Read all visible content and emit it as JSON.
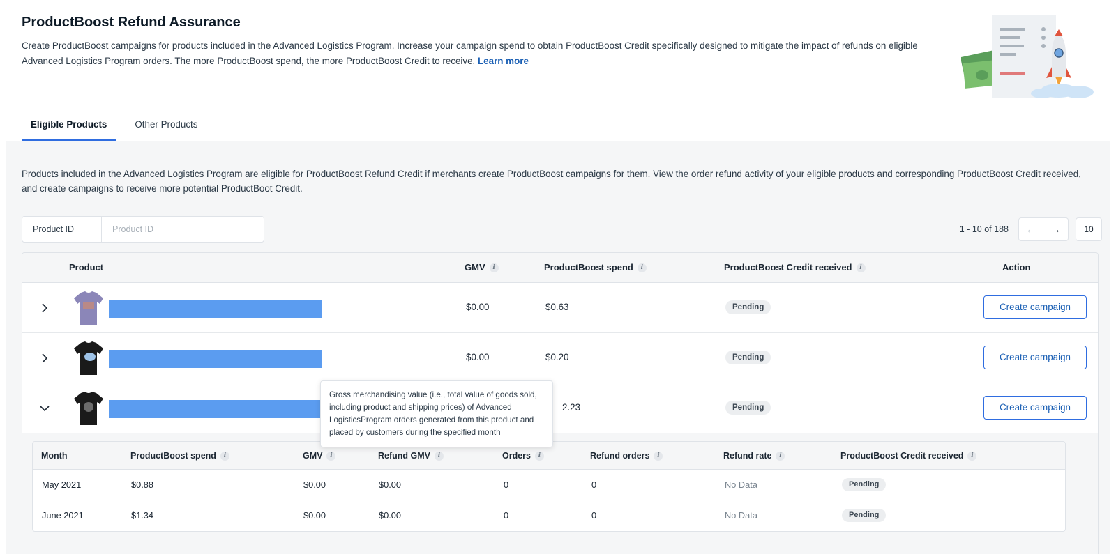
{
  "header": {
    "title": "ProductBoost Refund Assurance",
    "description": "Create ProductBoost campaigns for products included in the Advanced Logistics Program. Increase your campaign spend to obtain ProductBoost Credit specifically designed to mitigate the impact of refunds on eligible Advanced Logistics Program orders. The more ProductBoost spend, the more ProductBoost Credit to receive.",
    "learn_more": "Learn more"
  },
  "tabs": [
    {
      "label": "Eligible Products",
      "active": true
    },
    {
      "label": "Other Products",
      "active": false
    }
  ],
  "panel": {
    "description": "Products included in the Advanced Logistics Program are eligible for ProductBoost Refund Credit if merchants create ProductBoost campaigns for them. View the order refund activity of your eligible products and corresponding ProductBoost Credit received, and create campaigns to receive more potential ProductBoot Credit."
  },
  "filter": {
    "label": "Product ID",
    "placeholder": "Product ID"
  },
  "pagination": {
    "range": "1 - 10 of 188",
    "page_size": "10"
  },
  "table": {
    "columns": {
      "product": "Product",
      "gmv": "GMV",
      "spend": "ProductBoost spend",
      "credit": "ProductBoost Credit received",
      "action": "Action"
    },
    "rows": [
      {
        "gmv": "$0.00",
        "spend": "$0.63",
        "credit": "Pending",
        "action": "Create campaign",
        "expanded": false,
        "shirt_color": "#8b86b8"
      },
      {
        "gmv": "$0.00",
        "spend": "$0.20",
        "credit": "Pending",
        "action": "Create campaign",
        "expanded": false,
        "shirt_color": "#1a1a1a"
      },
      {
        "gmv": "",
        "spend": "2.23",
        "credit": "Pending",
        "action": "Create campaign",
        "expanded": true,
        "shirt_color": "#1a1a1a"
      }
    ]
  },
  "subtable": {
    "columns": {
      "month": "Month",
      "spend": "ProductBoost spend",
      "gmv": "GMV",
      "refund_gmv": "Refund GMV",
      "orders": "Orders",
      "refund_orders": "Refund orders",
      "refund_rate": "Refund rate",
      "credit": "ProductBoost Credit received"
    },
    "rows": [
      {
        "month": "May 2021",
        "spend": "$0.88",
        "gmv": "$0.00",
        "refund_gmv": "$0.00",
        "orders": "0",
        "refund_orders": "0",
        "refund_rate": "No Data",
        "credit": "Pending"
      },
      {
        "month": "June 2021",
        "spend": "$1.34",
        "gmv": "$0.00",
        "refund_gmv": "$0.00",
        "orders": "0",
        "refund_orders": "0",
        "refund_rate": "No Data",
        "credit": "Pending"
      }
    ]
  },
  "tooltip": {
    "text": "Gross merchandising value (i.e., total value of goods sold, including product and shipping prices) of Advanced LogisticsProgram orders generated from this product and placed by customers during the specified month"
  },
  "icons": {
    "info": "info-icon",
    "chevron_right": "chevron-right-icon",
    "chevron_down": "chevron-down-icon",
    "arrow_left": "arrow-left-icon",
    "arrow_right": "arrow-right-icon"
  },
  "colors": {
    "accent": "#2f6de0",
    "link": "#1a5fb4",
    "redacted_bar": "#5b9cf0",
    "panel_bg": "#f5f6f7"
  }
}
